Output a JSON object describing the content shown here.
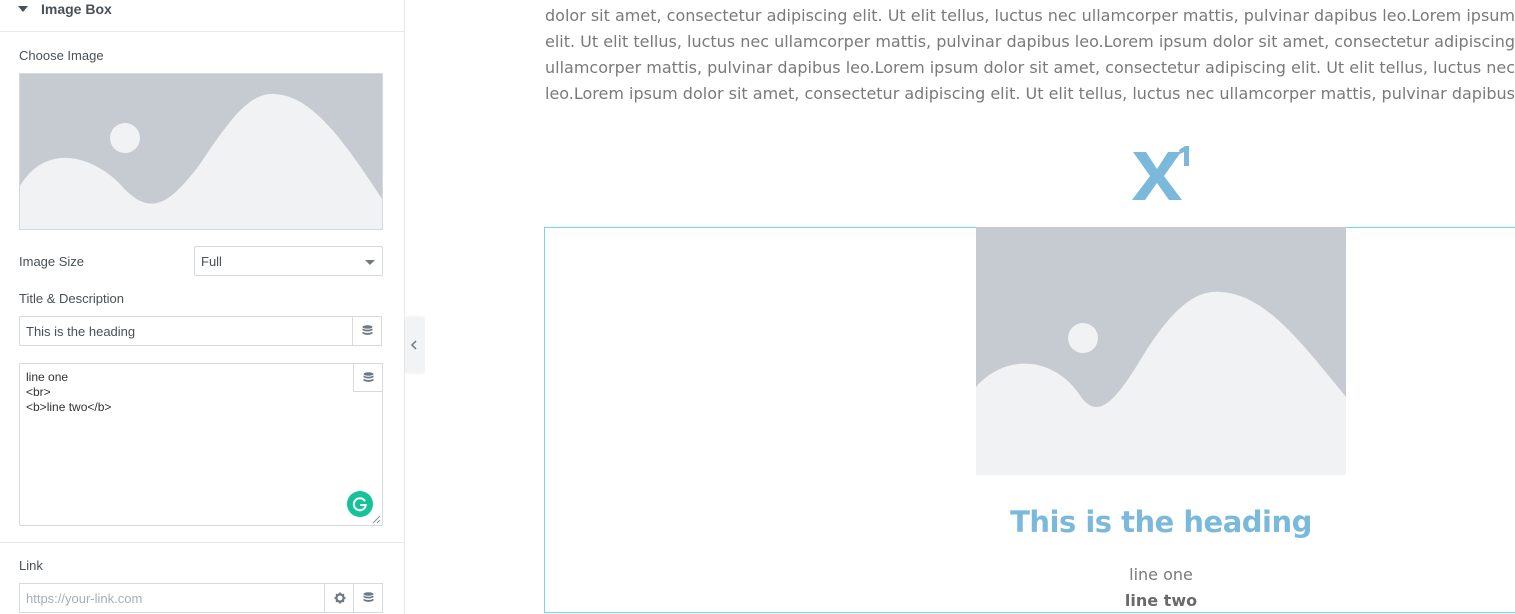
{
  "panel": {
    "section_title": "Image Box",
    "choose_image_label": "Choose Image",
    "image_size_label": "Image Size",
    "image_size_value": "Full",
    "title_desc_label": "Title & Description",
    "title_value": "This is the heading",
    "description_lines": [
      "line one",
      "<br>",
      "<b>line two</b>"
    ],
    "link_label": "Link",
    "link_placeholder": "https://your-link.com"
  },
  "preview": {
    "lorem_lines": [
      "dolor sit amet, consectetur adipiscing elit. Ut elit tellus, luctus nec ullamcorper mattis, pulvinar dapibus leo.Lorem ipsum dolor",
      "elit. Ut elit tellus, luctus nec ullamcorper mattis, pulvinar dapibus leo.Lorem ipsum dolor sit amet, consectetur adipiscing elit. Ut",
      "ullamcorper mattis, pulvinar dapibus leo.Lorem ipsum dolor sit amet, consectetur adipiscing elit. Ut elit tellus, luctus nec ullamc",
      "leo.Lorem ipsum dolor sit amet, consectetur adipiscing elit. Ut elit tellus, luctus nec ullamcorper mattis, pulvinar dapibus leo."
    ],
    "box_title": "This is the heading",
    "box_line_one": "line one",
    "box_line_two": "line two"
  },
  "colors": {
    "accent_heading": "#7ab8dc",
    "frame_border": "#71d7f7",
    "placeholder_bg": "#c5cbd1",
    "placeholder_fg": "#f1f2f4",
    "grammarly": "#15c39a"
  },
  "icons": {
    "section_caret": "caret-down-icon",
    "select_arrow": "chevron-down-icon",
    "dynamic_tags": "database-icon",
    "settings": "gear-icon",
    "grammarly": "grammarly-icon",
    "collapse": "chevron-left-icon",
    "superscript": "superscript-icon"
  }
}
